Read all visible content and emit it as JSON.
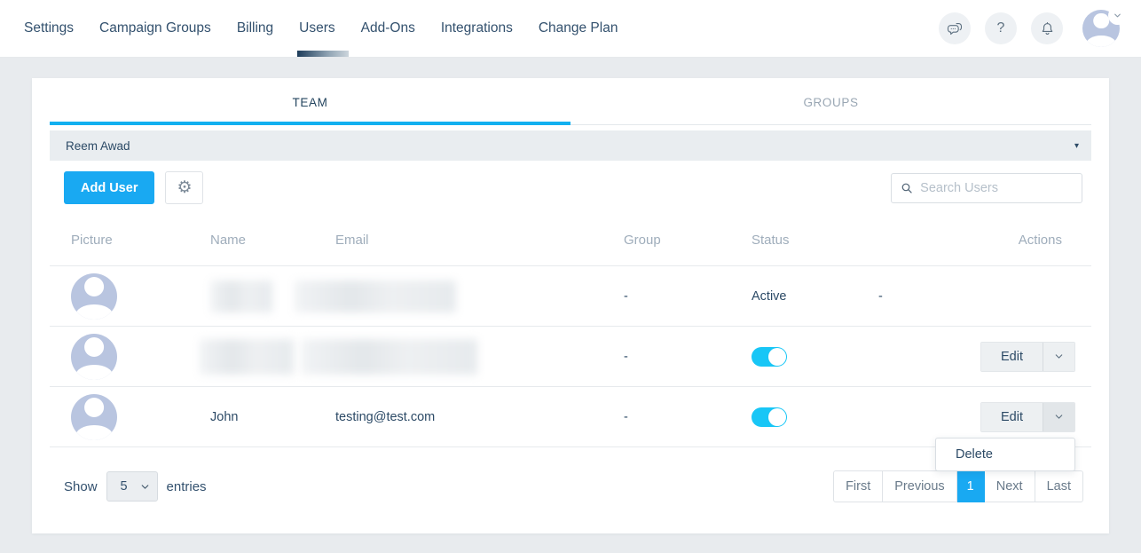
{
  "topnav": {
    "items": [
      {
        "label": "Settings",
        "active": false
      },
      {
        "label": "Campaign Groups",
        "active": false
      },
      {
        "label": "Billing",
        "active": false
      },
      {
        "label": "Users",
        "active": true
      },
      {
        "label": "Add-Ons",
        "active": false
      },
      {
        "label": "Integrations",
        "active": false
      },
      {
        "label": "Change Plan",
        "active": false
      }
    ],
    "icons": [
      "chat-icon",
      "help-icon",
      "notifications-icon",
      "avatar-menu"
    ],
    "help_glyph": "?"
  },
  "tabs": {
    "team": "TEAM",
    "groups": "GROUPS"
  },
  "accordion": {
    "title": "Reem Awad",
    "caret": "▾"
  },
  "toolbar": {
    "add_user_label": "Add User",
    "search_placeholder": "Search Users"
  },
  "table": {
    "headers": [
      "Picture",
      "Name",
      "Email",
      "Group",
      "Status",
      "Actions"
    ],
    "edit_label": "Edit",
    "menu_delete_label": "Delete",
    "rows": [
      {
        "redacted": true,
        "group": "-",
        "status": "Active",
        "actions": "-"
      },
      {
        "redacted": true,
        "group": "-",
        "status_toggle": "on"
      },
      {
        "name": "John",
        "email": "testing@test.com",
        "group": "-",
        "status_toggle": "on",
        "menu_open": true
      }
    ]
  },
  "footer": {
    "show_label": "Show",
    "page_size": "5",
    "entries_label": "entries",
    "pagination": [
      {
        "label": "First",
        "active": false
      },
      {
        "label": "Previous",
        "active": false
      },
      {
        "label": "1",
        "active": true
      },
      {
        "label": "Next",
        "active": false
      },
      {
        "label": "Last",
        "active": false
      }
    ]
  },
  "colors": {
    "accent_blue": "#19a9f2",
    "toggle_cyan": "#18c6f6",
    "tab_underline": "#12b0f0",
    "navy_text": "#2c4a66",
    "avatar_fill": "#b9c5e0",
    "page_background": "#e8ebee"
  }
}
